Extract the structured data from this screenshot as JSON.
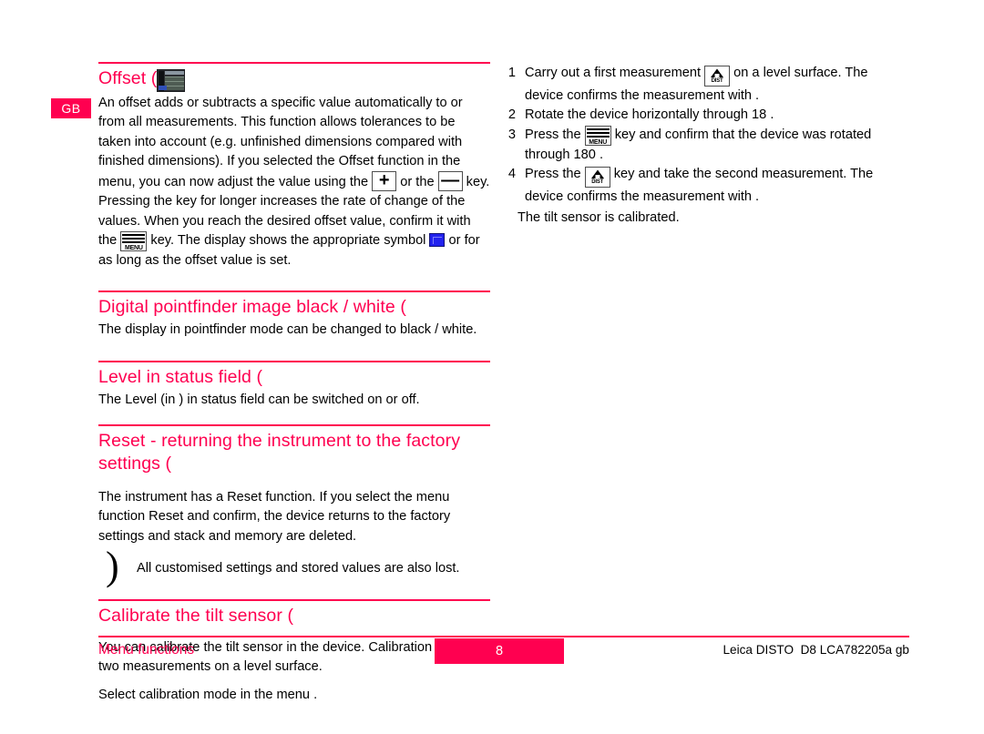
{
  "language_tab": {
    "label": "GB"
  },
  "left_column": {
    "sections": [
      {
        "id": "offset",
        "heading": "Offset (",
        "heading_icon": "device-menu-screen-thumbnail",
        "paragraphs": [
          {
            "runs": [
              {
                "text": "An offset adds or subtracts a specific value automatically to or from all measurements. This function allows tolerances to be taken into account (e.g. unfinished dimensions compared with finished dimensions). If you selected the Offset function in the menu, you can now adjust the value using the "
              },
              {
                "icon": "plus-key",
                "icon_label": "+"
              },
              {
                "text": " or the "
              },
              {
                "icon": "minus-key",
                "icon_label": "—"
              },
              {
                "text": " key. Pressing the key for longer increases the rate of change of the values. When you reach the desired offset value, confirm it with the "
              },
              {
                "icon": "menu-key",
                "icon_label": "MENU"
              },
              {
                "text": " key. The display shows the appropriate symbol "
              },
              {
                "icon": "blue-offset-symbol"
              },
              {
                "text": " or    for as long as the offset value is set."
              }
            ]
          }
        ]
      },
      {
        "id": "pointfinder",
        "heading": "Digital pointfinder image black / white (",
        "paragraphs": [
          {
            "text": "The display in pointfinder mode can be changed to black / white."
          }
        ]
      },
      {
        "id": "level-status-field",
        "heading": "Level in status field (",
        "paragraphs": [
          {
            "text": "The Level (in  ) in status field can be switched on or off."
          }
        ]
      },
      {
        "id": "reset",
        "heading": "Reset - returning the instrument to the factory settings (",
        "paragraphs": [
          {
            "text": "The instrument has a Reset function. If you select the menu function Reset and confirm, the device returns to the factory settings and stack and memory are deleted."
          }
        ],
        "note": {
          "symbol": ")",
          "text": "All customised settings and stored values are also lost."
        }
      },
      {
        "id": "calibrate-tilt-sensor",
        "heading": "Calibrate the tilt sensor (",
        "paragraphs": [
          {
            "text": "You can calibrate the tilt sensor in the device. Calibration requires two measurements on a level surface."
          },
          {
            "text": "Select calibration mode in the menu   ."
          }
        ]
      }
    ]
  },
  "right_column": {
    "steps": [
      {
        "number": "1",
        "runs": [
          {
            "text": "Carry out a first measurement "
          },
          {
            "icon": "dist-key",
            "icon_label": "DIST"
          },
          {
            "text": " on a level surface. The device confirms the measurement with      ."
          }
        ]
      },
      {
        "number": "2",
        "runs": [
          {
            "text": "Rotate the device horizontally through 18         ."
          }
        ]
      },
      {
        "number": "3",
        "runs": [
          {
            "text": "Press the "
          },
          {
            "icon": "menu-key",
            "icon_label": "MENU"
          },
          {
            "text": " key and confirm that the device was rotated through 180 ."
          }
        ]
      },
      {
        "number": "4",
        "runs": [
          {
            "text": "Press the "
          },
          {
            "icon": "dist-key",
            "icon_label": "DIST"
          },
          {
            "text": " key and take the second measurement. The device confirms the measurement with      ."
          }
        ]
      }
    ],
    "closing_text": "The tilt sensor is calibrated."
  },
  "footer": {
    "left_label": "Menu functions",
    "page_number": "8",
    "right_label": "Leica DISTO  D8 LCA782205a gb"
  },
  "colors": {
    "accent": "#ff0050",
    "text": "#000000",
    "background": "#ffffff",
    "offset_symbol_blue": "#2222ee"
  }
}
